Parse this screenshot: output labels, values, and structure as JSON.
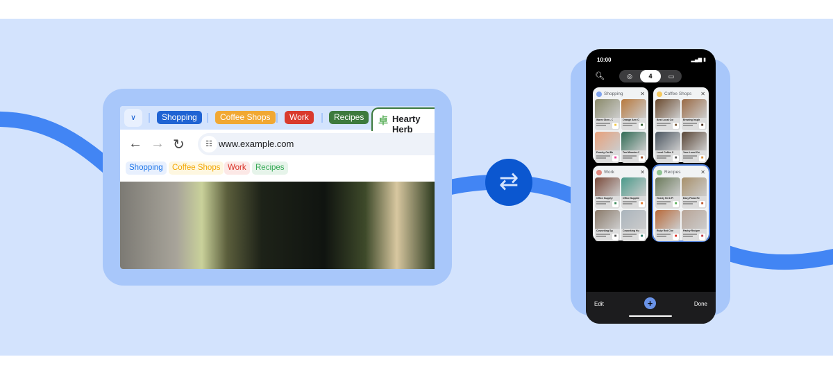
{
  "colors": {
    "band": "#d3e3fd",
    "line": "#4285f4",
    "card": "#a8c7fa",
    "swap": "#0b57d0"
  },
  "browser": {
    "tab_groups": [
      {
        "label": "Shopping",
        "color": "#1f63d3"
      },
      {
        "label": "Coffee Shops",
        "color": "#f1a833"
      },
      {
        "label": "Work",
        "color": "#d93a2d"
      },
      {
        "label": "Recipes",
        "color": "#3d7a3d"
      }
    ],
    "active_tab": {
      "title": "Hearty Herb",
      "icon": "recipe-icon"
    },
    "url": "www.example.com",
    "bookmarks": [
      {
        "label": "Shopping",
        "bg": "#e8f0fe",
        "fg": "#1a73e8"
      },
      {
        "label": "Coffee Shops",
        "bg": "#fef7e0",
        "fg": "#f2a600"
      },
      {
        "label": "Work",
        "bg": "#fce8e6",
        "fg": "#d93025"
      },
      {
        "label": "Recipes",
        "bg": "#e6f4ea",
        "fg": "#34a853"
      }
    ]
  },
  "swap_icon": "swap-arrows-icon",
  "phone": {
    "time": "10:00",
    "tab_count": "4",
    "groups": [
      {
        "name": "Shopping",
        "dot": "#7ea3ef",
        "tiles": [
          {
            "title": "Warm Glow - Chair",
            "img": "#8a8a6a",
            "fav": "#f2c744"
          },
          {
            "title": "Orange Arm Chair",
            "img": "#b8793d",
            "fav": "#2e5e2e"
          },
          {
            "title": "Peachy Cat Bed",
            "img": "#e8a07a",
            "fav": "#e8459a"
          },
          {
            "title": "Teal Wooden Dresser",
            "img": "#2f6b55",
            "fav": "#a0522d"
          }
        ]
      },
      {
        "name": "Coffee Shops",
        "dot": "#f6c95c",
        "tiles": [
          {
            "title": "Best Local Coffee Shops",
            "img": "#6b4a2e",
            "fav": "#7a5a3a"
          },
          {
            "title": "Brewing Inspiration",
            "img": "#9a6a44",
            "fav": "#4a2e1e"
          },
          {
            "title": "Local Coffee Shops",
            "img": "#4a5560",
            "fav": "#555"
          },
          {
            "title": "Your Local Coffee Shop",
            "img": "#5a4636",
            "fav": "#d9903a"
          }
        ]
      },
      {
        "name": "Work",
        "dot": "#e0877d",
        "tiles": [
          {
            "title": "Office Supply Depot",
            "img": "#7a4a3a",
            "fav": "#3a8a5a"
          },
          {
            "title": "Office Supplies",
            "img": "#4a9a8a",
            "fav": "#e07a2e"
          },
          {
            "title": "Coworking Spaces",
            "img": "#8a7a6a",
            "fav": "#555"
          },
          {
            "title": "Coworking Hubs",
            "img": "#aab4bc",
            "fav": "#2e7a6a"
          }
        ]
      },
      {
        "name": "Recipes",
        "dot": "#8fc493",
        "selected": true,
        "tiles": [
          {
            "title": "Hearty Herb Pie",
            "img": "#6a7a5a",
            "fav": "#5bb05b"
          },
          {
            "title": "Easy Pasta Recipes",
            "img": "#a8906a",
            "fav": "#c0582e"
          },
          {
            "title": "Ruby Red Cherry Pie",
            "img": "#b86a3a",
            "fav": "#d93025"
          },
          {
            "title": "Pastry Recipes",
            "img": "#b8a496",
            "fav": "#c0404a"
          }
        ]
      }
    ],
    "edit_label": "Edit",
    "done_label": "Done"
  }
}
